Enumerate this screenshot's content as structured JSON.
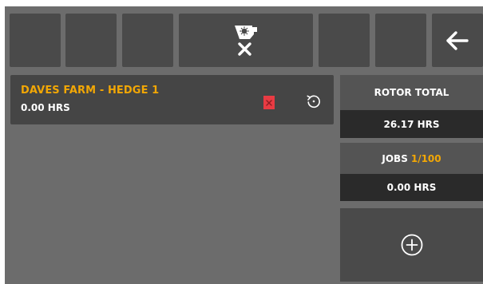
{
  "toolbar": {
    "buttons": [
      "",
      "",
      "",
      "machine-cancel",
      "",
      "",
      "back"
    ]
  },
  "job": {
    "name": "DAVES FARM - HEDGE 1",
    "hours": "0.00 HRS"
  },
  "rotor": {
    "label": "ROTOR TOTAL",
    "value": "26.17 HRS"
  },
  "jobs": {
    "label": "JOBS",
    "count": "1/100",
    "value": "0.00 HRS"
  },
  "colors": {
    "accent": "#f2a705",
    "delete": "#e83b43",
    "background": "#6c6c6c",
    "button": "#4a4a4a"
  },
  "icons": [
    "machine-icon",
    "close-icon",
    "back-arrow-icon",
    "delete-icon",
    "reset-icon",
    "add-circle-icon"
  ]
}
